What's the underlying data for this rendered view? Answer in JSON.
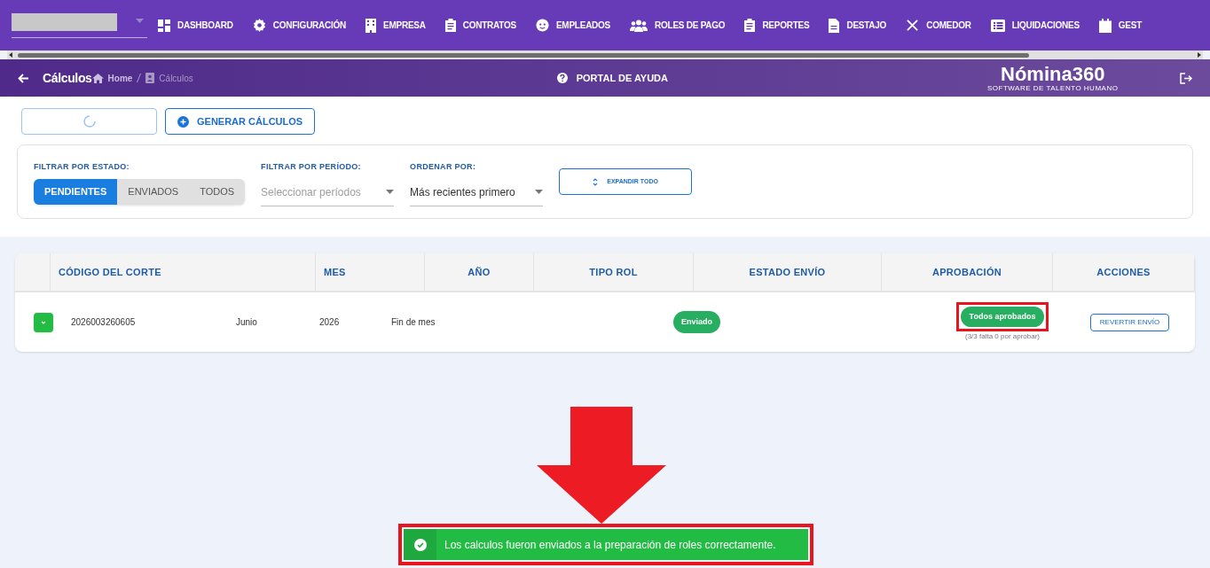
{
  "nav": {
    "items": [
      {
        "label": "DASHBOARD"
      },
      {
        "label": "CONFIGURACIÓN"
      },
      {
        "label": "EMPRESA"
      },
      {
        "label": "CONTRATOS"
      },
      {
        "label": "EMPLEADOS"
      },
      {
        "label": "ROLES DE PAGO"
      },
      {
        "label": "REPORTES"
      },
      {
        "label": "DESTAJO"
      },
      {
        "label": "COMEDOR"
      },
      {
        "label": "LIQUIDACIONES"
      },
      {
        "label": "GEST"
      }
    ]
  },
  "header": {
    "title": "Cálculos",
    "breadcrumb": [
      "Home",
      "Cálculos"
    ],
    "help": "PORTAL DE AYUDA",
    "logo": "Nómina360",
    "logo_tagline": "SOFTWARE DE TALENTO HUMANO"
  },
  "actions": {
    "loading": true,
    "generate": "GENERAR CÁLCULOS"
  },
  "filters": {
    "estado": {
      "label": "FILTRAR POR ESTADO:",
      "options": [
        {
          "label": "PENDIENTES",
          "selected": true
        },
        {
          "label": "ENVIADOS",
          "selected": false
        },
        {
          "label": "TODOS",
          "selected": false
        }
      ]
    },
    "periodo": {
      "label": "FILTRAR POR PERÍODO:",
      "placeholder": "Seleccionar períodos"
    },
    "orden": {
      "label": "ORDENAR POR:",
      "value": "Más recientes primero"
    },
    "expand": "EXPANDIR TODO"
  },
  "table": {
    "columns": [
      "CÓDIGO DEL CORTE",
      "MES",
      "AÑO",
      "TIPO ROL",
      "ESTADO ENVÍO",
      "APROBACIÓN",
      "ACCIONES"
    ],
    "rows": [
      {
        "codigo": "2026003260605",
        "mes": "Junio",
        "anio": "2026",
        "tipo": "Fin de mes",
        "estado": "Enviado",
        "aprobacion": "Todos aprobados",
        "aprobacion_detalle": "(3/3 falta 0 por aprobar)",
        "accion": "REVERTIR ENVÍO",
        "expanded": false
      }
    ]
  },
  "toast": {
    "message": "Los calculos fueron enviados a la preparación de roles correctamente."
  }
}
